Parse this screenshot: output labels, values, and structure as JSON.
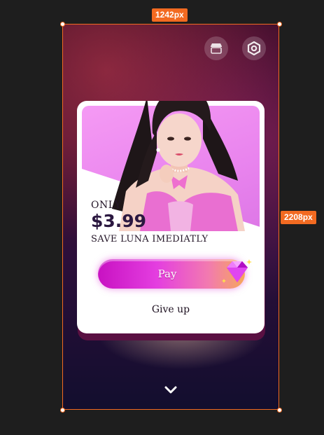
{
  "canvas": {
    "width_label": "1242px",
    "height_label": "2208px",
    "accent_color": "#f26a21"
  },
  "top_bar": {
    "shop_icon": "shop-icon",
    "settings_icon": "settings-icon"
  },
  "offer": {
    "only_label": "ONLY",
    "price": "$3.99",
    "description": "SAVE LUNA IMEDIATLY",
    "pay_label": "Pay",
    "pay_icon": "gem-icon",
    "give_up_label": "Give up",
    "hero_image": "woman-portrait"
  },
  "bottom": {
    "icon": "chevron-down-icon"
  },
  "colors": {
    "card_bg": "#ffffff",
    "hero_bg": "#f59af4",
    "pay_gradient_start": "#c812c2",
    "pay_gradient_end": "#f6a85a",
    "text_dark": "#241628"
  }
}
